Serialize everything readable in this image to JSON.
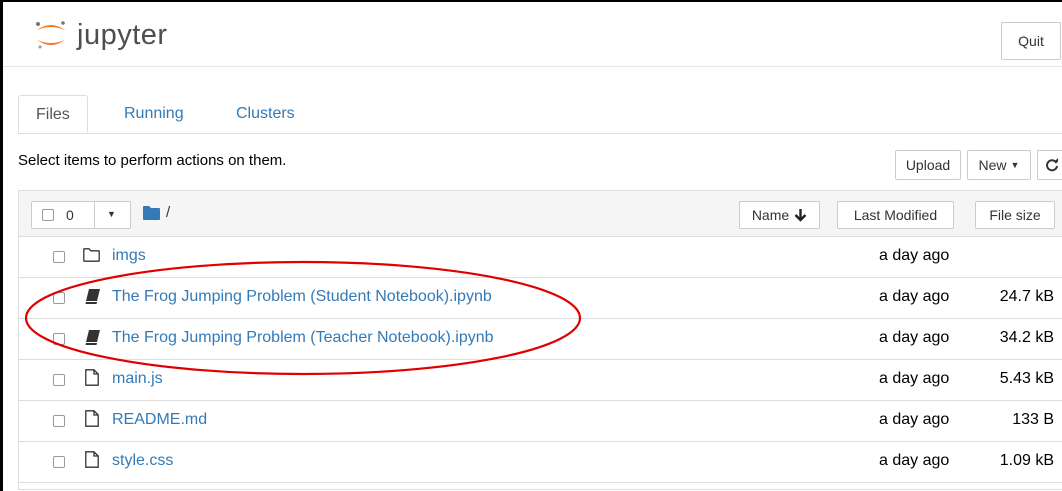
{
  "header": {
    "logo_text": "jupyter",
    "quit_label": "Quit"
  },
  "tabs": [
    {
      "label": "Files",
      "active": true
    },
    {
      "label": "Running",
      "active": false
    },
    {
      "label": "Clusters",
      "active": false
    }
  ],
  "toolbar": {
    "instructions": "Select items to perform actions on them.",
    "upload_label": "Upload",
    "new_label": "New"
  },
  "list_header": {
    "selected_count": "0",
    "breadcrumb": "/",
    "sort_name_label": "Name",
    "last_modified_label": "Last Modified",
    "file_size_label": "File size"
  },
  "rows": [
    {
      "name": "imgs",
      "type": "folder",
      "modified": "a day ago",
      "size": ""
    },
    {
      "name": "The Frog Jumping Problem (Student Notebook).ipynb",
      "type": "notebook",
      "modified": "a day ago",
      "size": "24.7 kB"
    },
    {
      "name": "The Frog Jumping Problem (Teacher Notebook).ipynb",
      "type": "notebook",
      "modified": "a day ago",
      "size": "34.2 kB"
    },
    {
      "name": "main.js",
      "type": "file",
      "modified": "a day ago",
      "size": "5.43 kB"
    },
    {
      "name": "README.md",
      "type": "file",
      "modified": "a day ago",
      "size": "133 B"
    },
    {
      "name": "style.css",
      "type": "file",
      "modified": "a day ago",
      "size": "1.09 kB"
    }
  ],
  "colors": {
    "link": "#337ab7",
    "annotation": "#e00000",
    "jupyter_orange": "#f37726"
  }
}
